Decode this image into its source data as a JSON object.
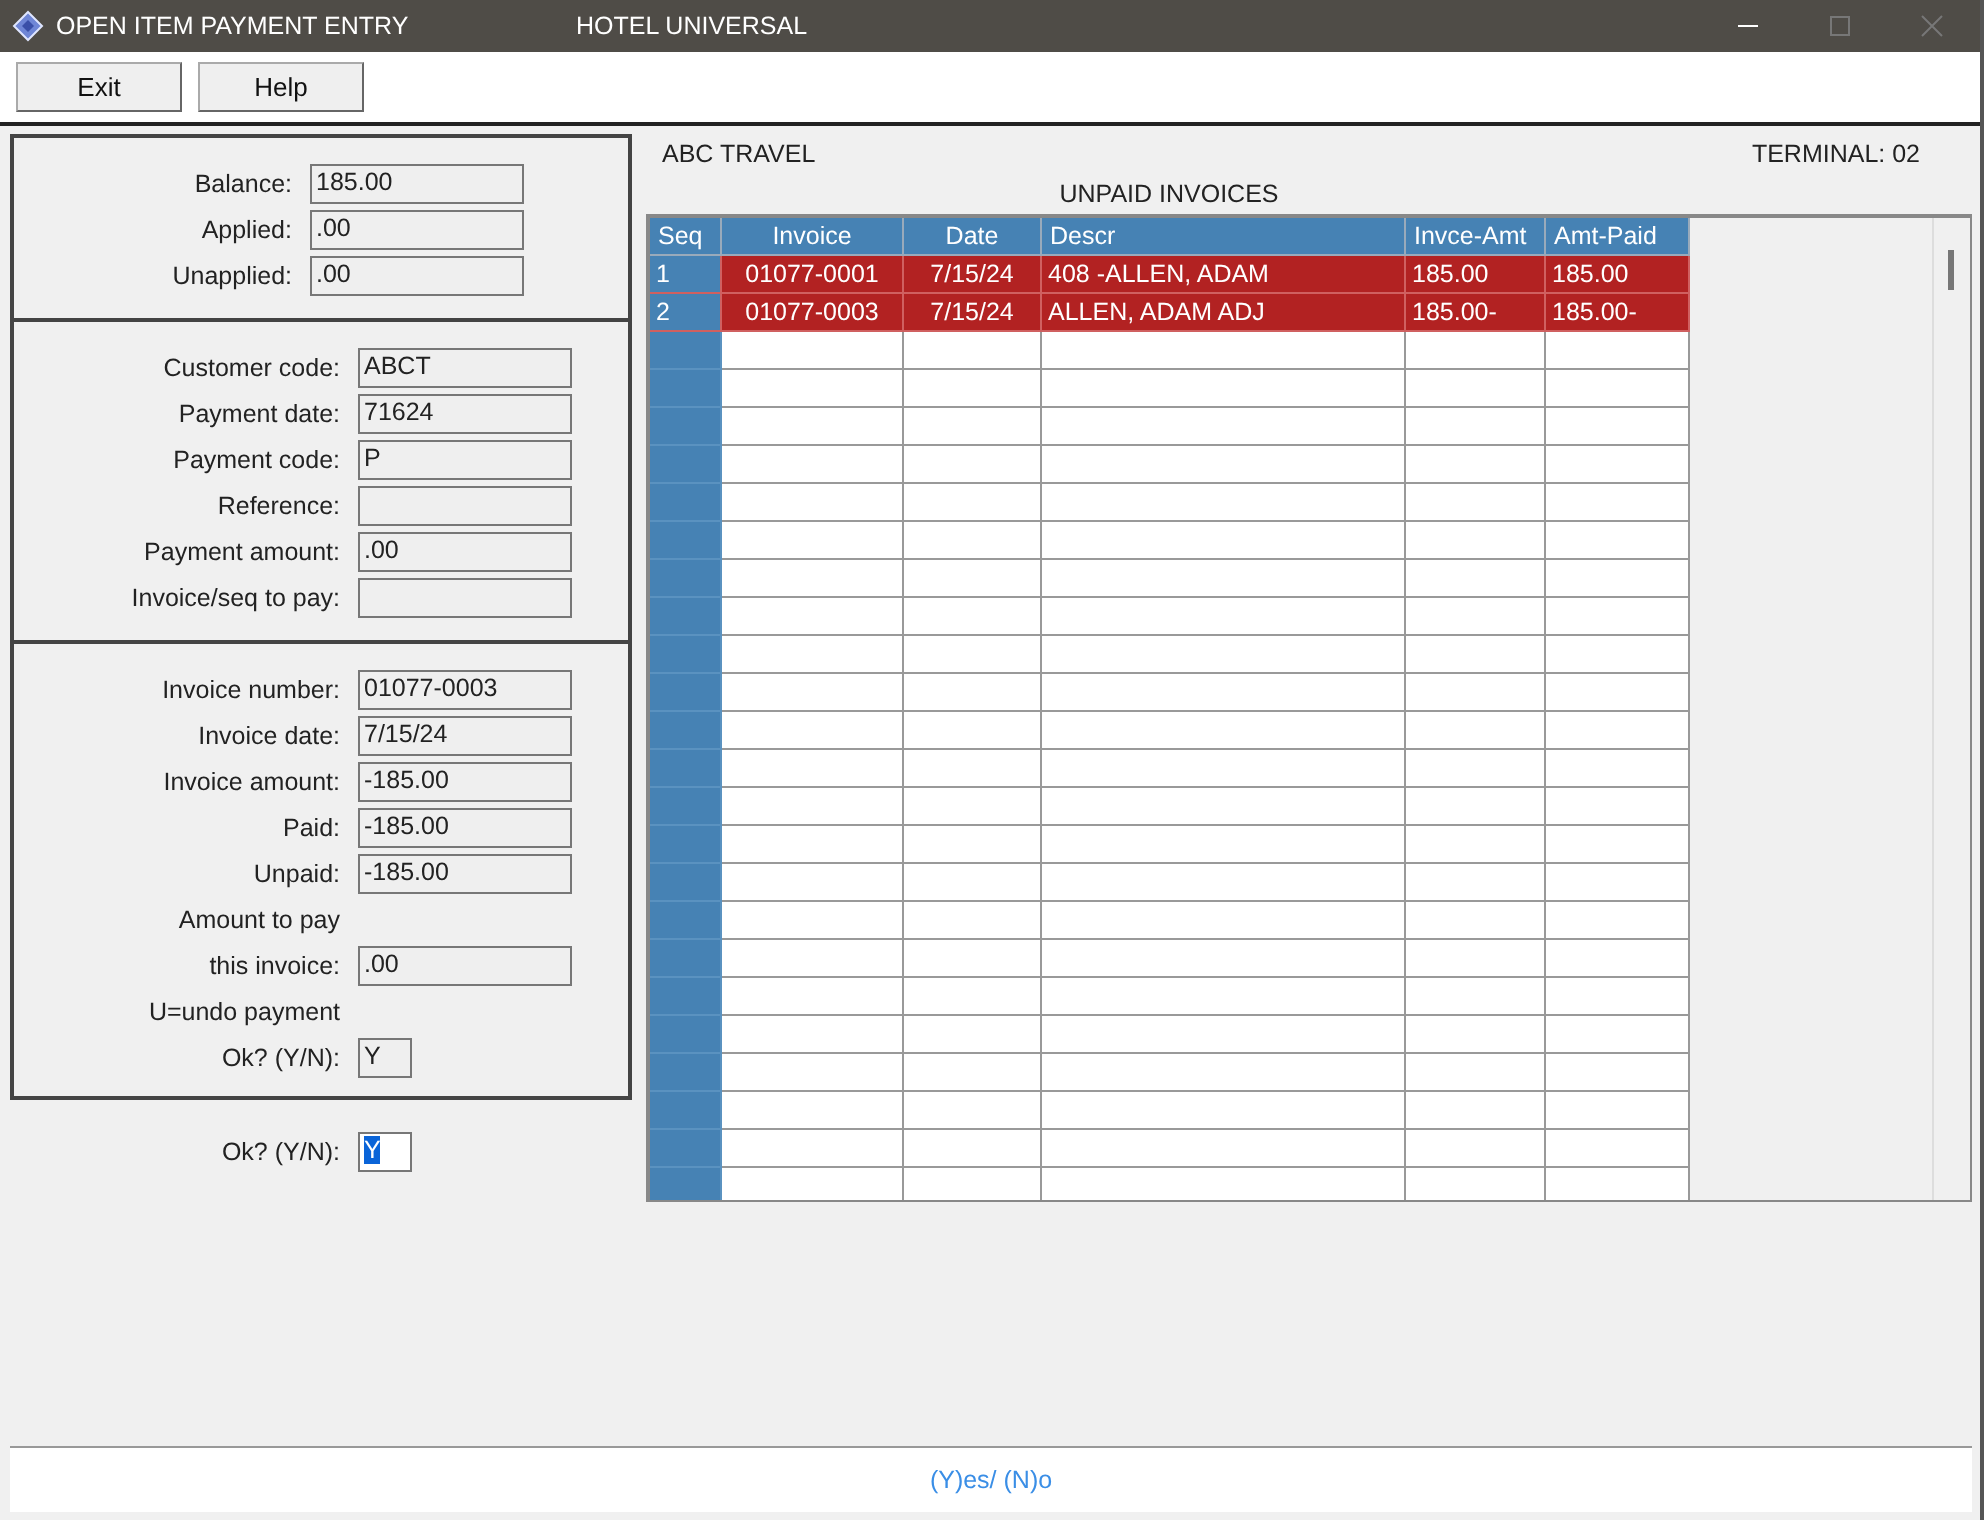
{
  "window": {
    "title": "OPEN ITEM PAYMENT ENTRY",
    "subtitle": "HOTEL UNIVERSAL"
  },
  "toolbar": {
    "buttons": [
      "Exit",
      "Help"
    ]
  },
  "summary": [
    {
      "label": "Balance:",
      "value": "185.00"
    },
    {
      "label": "Applied:",
      "value": ".00"
    },
    {
      "label": "Unapplied:",
      "value": ".00"
    }
  ],
  "payment": [
    {
      "label": "Customer code:",
      "value": "ABCT"
    },
    {
      "label": "Payment date:",
      "value": "71624"
    },
    {
      "label": "Payment code:",
      "value": "P"
    },
    {
      "label": "Reference:"
    },
    {
      "label": "Payment amount:",
      "value": ".00"
    },
    {
      "label": "Invoice/seq to pay:"
    }
  ],
  "invoice": [
    {
      "kind": "field",
      "label": "Invoice number:",
      "value": "01077-0003"
    },
    {
      "kind": "field",
      "label": "Invoice date:",
      "value": "7/15/24"
    },
    {
      "kind": "field",
      "label": "Invoice amount:",
      "value": "-185.00"
    },
    {
      "kind": "field",
      "label": "Paid:",
      "value": "-185.00"
    },
    {
      "kind": "field",
      "label": "Unpaid:",
      "value": "-185.00"
    },
    {
      "kind": "note",
      "label": "Amount to pay"
    },
    {
      "kind": "field",
      "label": "this invoice:",
      "value": ".00"
    },
    {
      "kind": "note",
      "label": "U=undo payment"
    },
    {
      "kind": "short",
      "label": "Ok? (Y/N):",
      "value": "Y"
    }
  ],
  "confirm": {
    "label": "Ok? (Y/N):",
    "value": "Y",
    "focused": true
  },
  "customer": "ABC TRAVEL",
  "terminal": "TERMINAL: 02",
  "table": {
    "title": "UNPAID INVOICES",
    "columns": [
      "Seq",
      "Invoice",
      "Date",
      "Descr",
      "Invce-Amt",
      "Amt-Paid"
    ],
    "rows": [
      {
        "cells": [
          "1",
          "01077-0001",
          "7/15/24",
          "408 -ALLEN, ADAM",
          "185.00",
          "185.00"
        ],
        "selected": true
      },
      {
        "cells": [
          "2",
          "01077-0003",
          "7/15/24",
          "ALLEN, ADAM ADJ",
          "185.00-",
          "185.00-"
        ],
        "selected": true
      }
    ]
  },
  "status_bar": "(Y)es/ (N)o"
}
